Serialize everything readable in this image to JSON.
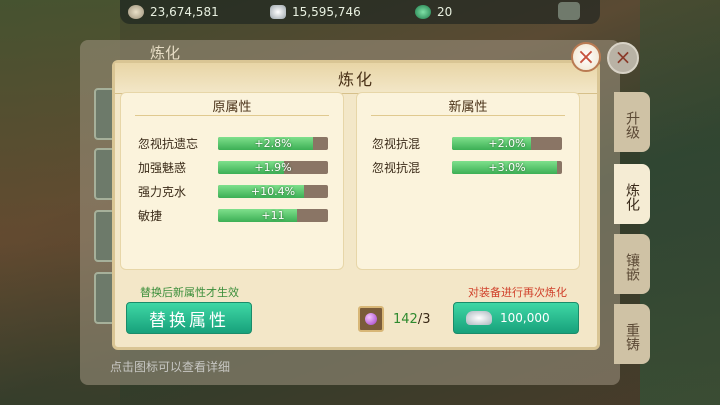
{
  "top_bar": {
    "gold": "23,674,581",
    "silver": "15,595,746",
    "jade": "20",
    "gold_icon": "gold-coin-icon",
    "silver_icon": "silver-ingot-icon",
    "jade_icon": "jade-icon"
  },
  "background": {
    "panel_title": "炼化",
    "tabs": [
      "升级",
      "炼化",
      "镶嵌",
      "重铸"
    ],
    "active_tab": "炼化",
    "bottom_hint": "点击图标可以查看详细"
  },
  "dialog": {
    "title": "炼化",
    "close_icon": "close-icon",
    "original": {
      "heading": "原属性",
      "attributes": [
        {
          "name": "忽视抗遗忘",
          "value": "+2.8%",
          "fill": 0.86
        },
        {
          "name": "加强魅惑",
          "value": "+1.9%",
          "fill": 0.6
        },
        {
          "name": "强力克水",
          "value": "+10.4%",
          "fill": 0.78
        },
        {
          "name": "敏捷",
          "value": "+11",
          "fill": 0.72
        }
      ]
    },
    "new": {
      "heading": "新属性",
      "attributes": [
        {
          "name": "忽视抗混",
          "value": "+2.0%",
          "fill": 0.72
        },
        {
          "name": "忽视抗混",
          "value": "+3.0%",
          "fill": 0.95
        }
      ]
    },
    "replace_hint": "替换后新属性才生效",
    "replace_button": "替换属性",
    "refine_hint": "对装备进行再次炼化",
    "material": {
      "icon": "purple-gem-icon",
      "owned": "142",
      "required": "/3"
    },
    "refine_button": {
      "icon": "silver-ingot-icon",
      "cost": "100,000"
    },
    "colors": {
      "button": "#1fb388",
      "hint_green": "#3a8e3a",
      "hint_red": "#d0402a",
      "bar_fill": "#3caf55"
    }
  }
}
